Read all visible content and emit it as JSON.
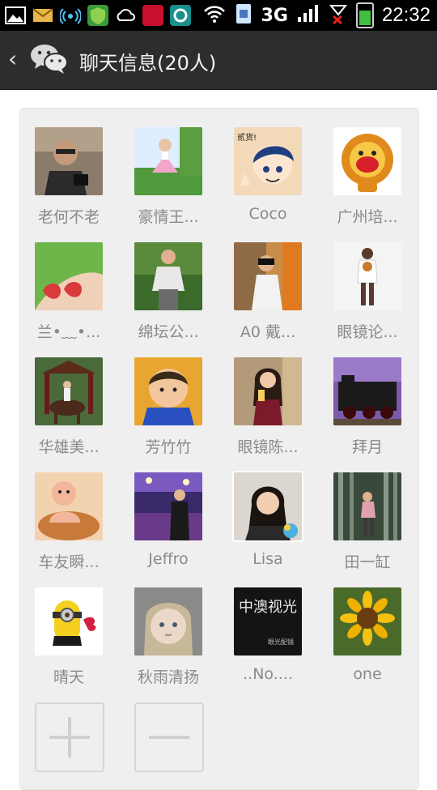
{
  "status_bar": {
    "network": "3G",
    "time": "22:32",
    "icons": [
      "gallery-icon",
      "mail-icon",
      "hotspot-icon",
      "shield-icon",
      "cloud-icon",
      "news-icon",
      "app-icon",
      "wifi-icon",
      "sim-icon",
      "signal-icon",
      "battery-icon"
    ]
  },
  "header": {
    "back_label": "‹",
    "title": "聊天信息(20人)"
  },
  "members": [
    {
      "name": "老何不老"
    },
    {
      "name": "豪情王..."
    },
    {
      "name": "Coco"
    },
    {
      "name": "广州培..."
    },
    {
      "name": "兰•﹏•..."
    },
    {
      "name": "绵坛公..."
    },
    {
      "name": "A0 戴..."
    },
    {
      "name": "眼镜论..."
    },
    {
      "name": "华雄美..."
    },
    {
      "name": "芳竹竹"
    },
    {
      "name": "眼镜陈..."
    },
    {
      "name": "拜月"
    },
    {
      "name": "车友瞬..."
    },
    {
      "name": "Jeffro"
    },
    {
      "name": "Lisa"
    },
    {
      "name": "田一缸"
    },
    {
      "name": "晴天"
    },
    {
      "name": "秋雨清扬"
    },
    {
      "name": "..No...."
    },
    {
      "name": "one"
    }
  ],
  "avatar_texts": {
    "coco_caption": "贰货!",
    "glasses_sign": "中澳视光",
    "glasses_sub": "眼光配镜"
  },
  "actions": {
    "add_icon": "add-member-icon",
    "remove_icon": "remove-member-icon"
  },
  "colors": {
    "title_bar": "#2d2d2d",
    "panel": "#efefef",
    "name_text": "#8a8a8a"
  }
}
